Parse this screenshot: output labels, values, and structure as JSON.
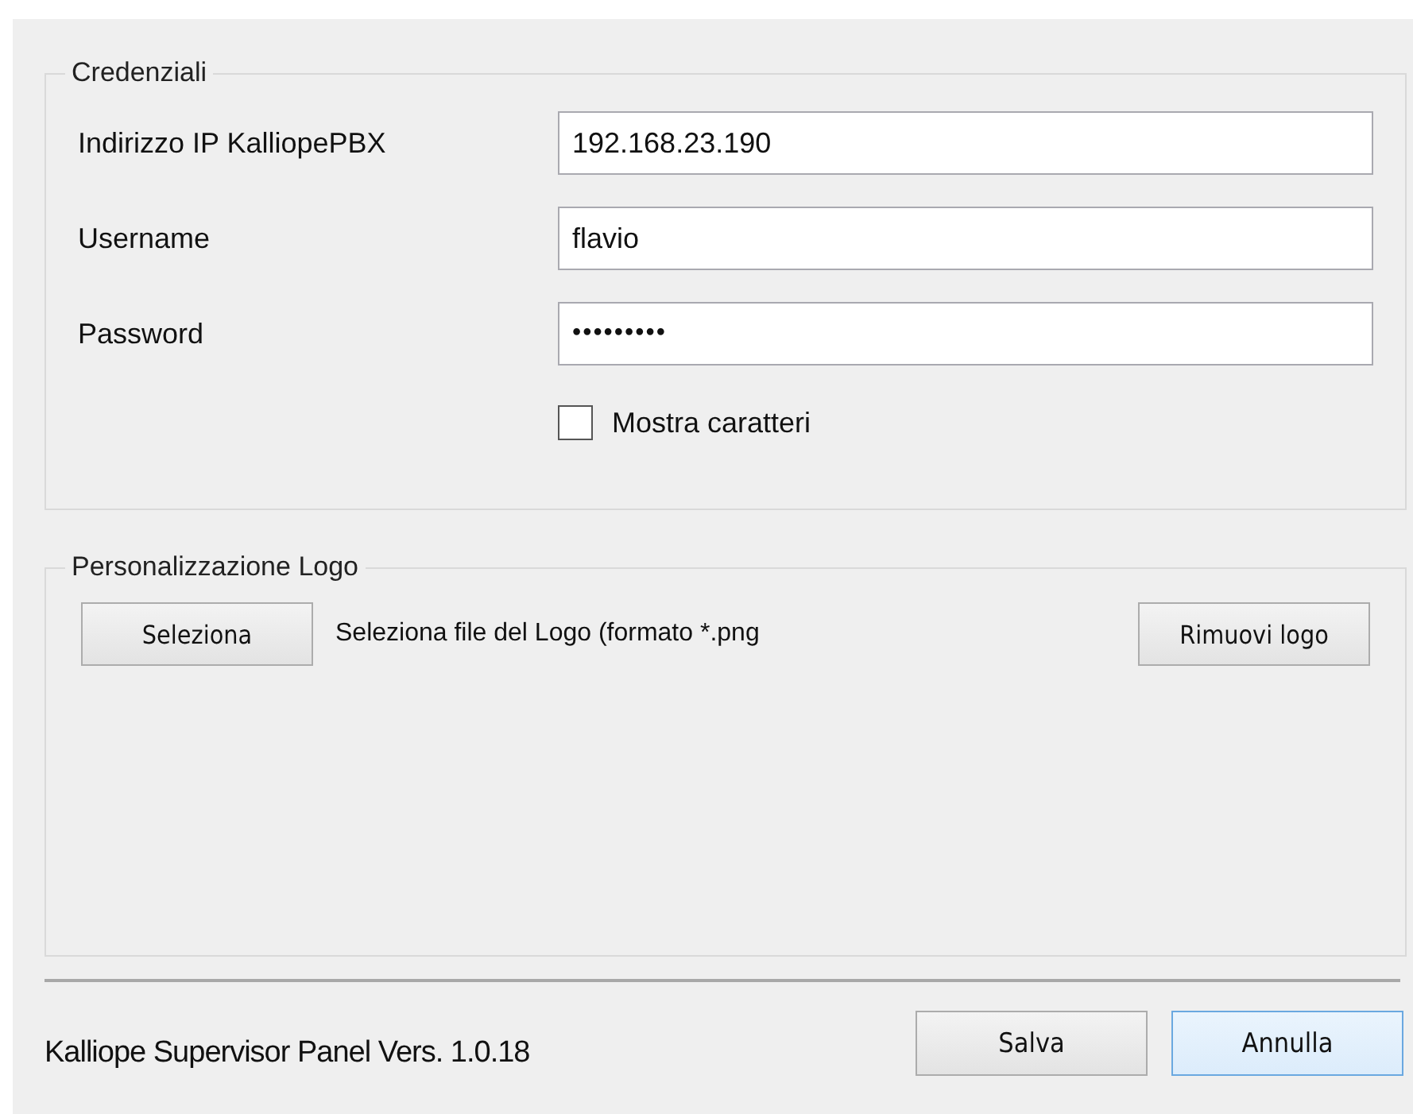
{
  "credentials": {
    "title": "Credenziali",
    "fields": [
      {
        "label": "Indirizzo IP KalliopePBX",
        "value": "192.168.23.190",
        "kind": "text"
      },
      {
        "label": "Username",
        "value": "flavio",
        "kind": "text"
      },
      {
        "label": "Password",
        "value": "•••••••••",
        "kind": "password"
      }
    ],
    "show_characters": {
      "label": "Mostra caratteri",
      "checked": false
    }
  },
  "logo": {
    "title": "Personalizzazione Logo",
    "select_button": "Seleziona",
    "hint": "Seleziona file del Logo (formato *.png",
    "remove_button": "Rimuovi logo"
  },
  "footer": {
    "version": "Kalliope Supervisor Panel Vers. 1.0.18",
    "buttons": [
      {
        "label": "Salva",
        "focused": false
      },
      {
        "label": "Annulla",
        "focused": true
      }
    ]
  }
}
